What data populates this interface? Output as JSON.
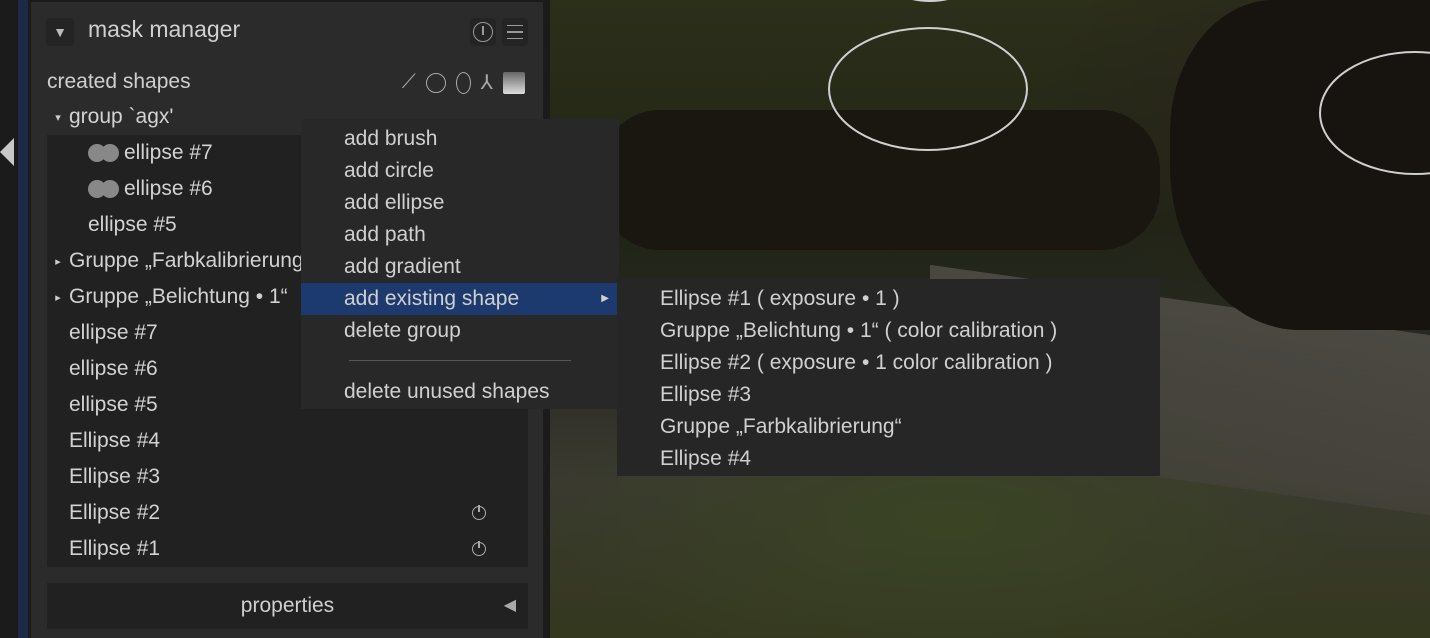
{
  "panel": {
    "title": "mask manager",
    "subtitle": "created shapes",
    "properties_label": "properties"
  },
  "tree": [
    {
      "label": "group `agx'",
      "level": 0,
      "expander": "expanded"
    },
    {
      "label": "ellipse #7",
      "level": 1,
      "icon": "used-shape"
    },
    {
      "label": "ellipse #6",
      "level": 1,
      "icon": "used-shape"
    },
    {
      "label": "ellipse #5",
      "level": 1
    },
    {
      "label": "Gruppe „Farbkalibrierung“",
      "level": 0,
      "expander": "collapsed"
    },
    {
      "label": "Gruppe „Belichtung • 1“",
      "level": 0,
      "expander": "collapsed"
    },
    {
      "label": "ellipse #7",
      "level": 0
    },
    {
      "label": "ellipse #6",
      "level": 0
    },
    {
      "label": "ellipse #5",
      "level": 0
    },
    {
      "label": "Ellipse #4",
      "level": 0
    },
    {
      "label": "Ellipse #3",
      "level": 0
    },
    {
      "label": "Ellipse #2",
      "level": 0,
      "power": true
    },
    {
      "label": "Ellipse #1",
      "level": 0,
      "power": true
    }
  ],
  "menu": {
    "items": [
      "add brush",
      "add circle",
      "add ellipse",
      "add path",
      "add gradient",
      "add existing shape",
      "delete group",
      "delete unused shapes"
    ],
    "selected": "add existing shape"
  },
  "submenu": {
    "items": [
      "Ellipse #1 ( exposure • 1 )",
      "Gruppe „Belichtung • 1“ ( color calibration )",
      "Ellipse #2 ( exposure • 1 color calibration )",
      "Ellipse #3",
      "Gruppe „Farbkalibrierung“",
      "Ellipse #4"
    ]
  },
  "colors": {
    "highlight": "#1c3a6e",
    "panel": "#2b2b2b",
    "list": "#212121"
  }
}
